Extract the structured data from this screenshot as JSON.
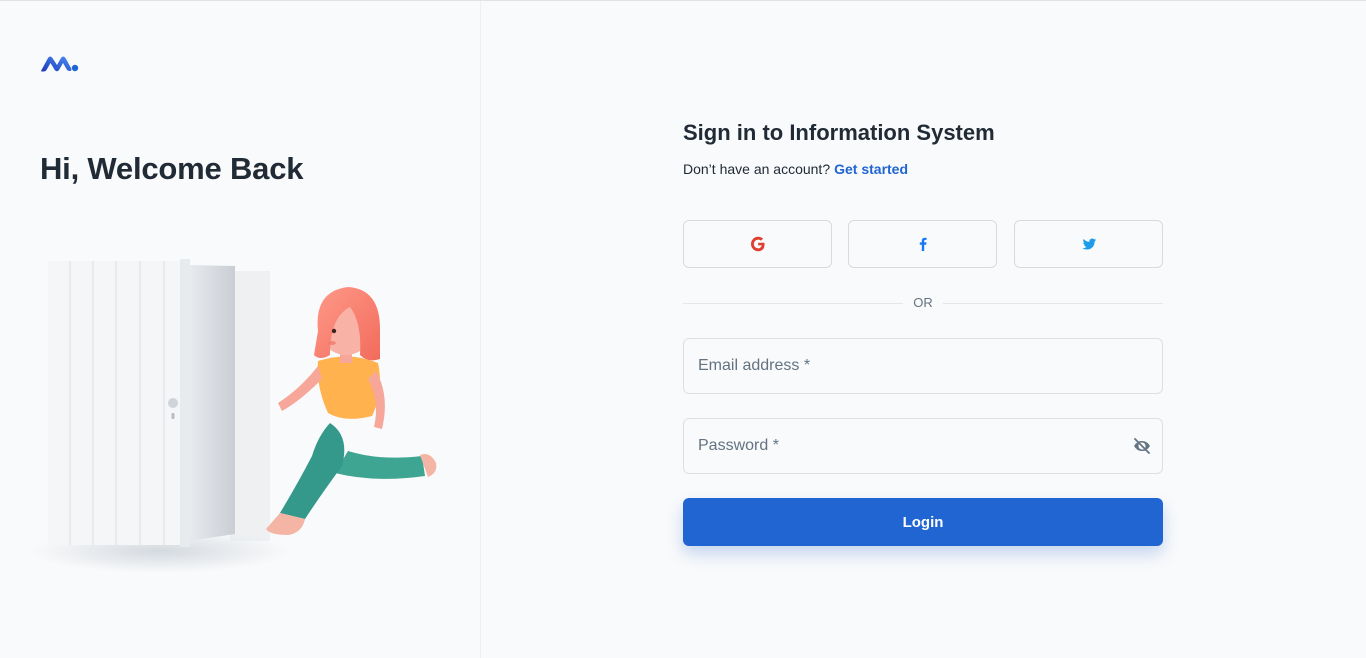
{
  "left": {
    "logo_icon": "minimal-logo-icon",
    "welcome": "Hi, Welcome Back",
    "illustration": "girl-running-through-door-illustration"
  },
  "form": {
    "title": "Sign in to Information System",
    "subtitle_text": "Don’t have an account?",
    "get_started": "Get started",
    "social": [
      {
        "name": "google",
        "icon": "google-icon",
        "color": "#df3e30"
      },
      {
        "name": "facebook",
        "icon": "facebook-icon",
        "color": "#1877f2"
      },
      {
        "name": "twitter",
        "icon": "twitter-icon",
        "color": "#1c9cea"
      }
    ],
    "divider": "OR",
    "email_label": "Email address *",
    "password_label": "Password *",
    "login_label": "Login"
  },
  "colors": {
    "primary": "#2065d1",
    "text": "#212b36",
    "muted": "#637381",
    "background": "#f9fafb"
  }
}
